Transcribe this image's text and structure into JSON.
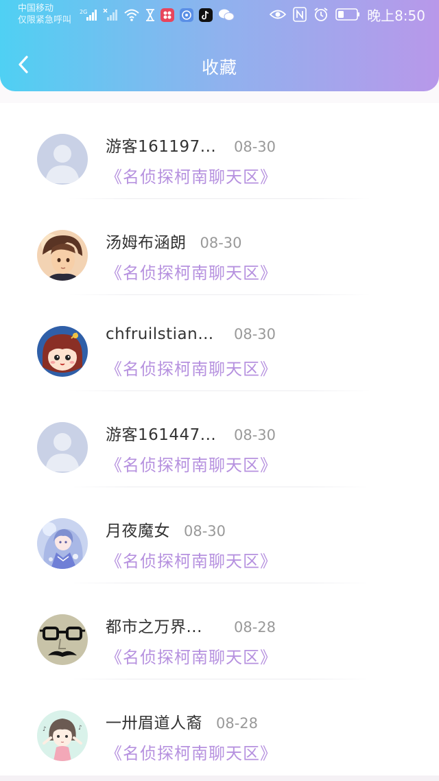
{
  "status_bar": {
    "carrier_line1": "中国移动",
    "carrier_line2": "仅限紧急呼叫",
    "network": "2G",
    "clock": "晚上8:50",
    "icons": [
      "signal-icon",
      "no-signal-icon",
      "wifi-icon",
      "hourglass-icon",
      "app-kugou-icon",
      "app-music-icon",
      "app-tiktok-icon",
      "wechat-icon",
      "eye-icon",
      "nfc-icon",
      "alarm-icon",
      "battery-icon"
    ]
  },
  "header": {
    "title": "收藏",
    "back_icon": "chevron-left-icon",
    "gradient_start": "#4fd0f3",
    "gradient_end": "#b898ea"
  },
  "items": [
    {
      "username": "游客161197...",
      "date": "08-30",
      "topic": "《名侦探柯南聊天区》",
      "avatar": "default-avatar"
    },
    {
      "username": "汤姆布涵朗",
      "date": "08-30",
      "topic": "《名侦探柯南聊天区》",
      "avatar": "anime-boy-avatar"
    },
    {
      "username": "chfruilstiandi...",
      "date": "08-30",
      "topic": "《名侦探柯南聊天区》",
      "avatar": "cartoon-girl-avatar"
    },
    {
      "username": "游客161447...",
      "date": "08-30",
      "topic": "《名侦探柯南聊天区》",
      "avatar": "default-avatar"
    },
    {
      "username": "月夜魔女",
      "date": "08-30",
      "topic": "《名侦探柯南聊天区》",
      "avatar": "anime-witch-avatar"
    },
    {
      "username": "都市之万界...",
      "date": "08-28",
      "topic": "《名侦探柯南聊天区》",
      "avatar": "glasses-mustache-avatar"
    },
    {
      "username": "一卅眉道人裔",
      "date": "08-28",
      "topic": "《名侦探柯南聊天区》",
      "avatar": "chibi-girl-avatar"
    }
  ],
  "colors": {
    "topic_link": "#b691df",
    "date": "#999999",
    "username": "#333333"
  }
}
